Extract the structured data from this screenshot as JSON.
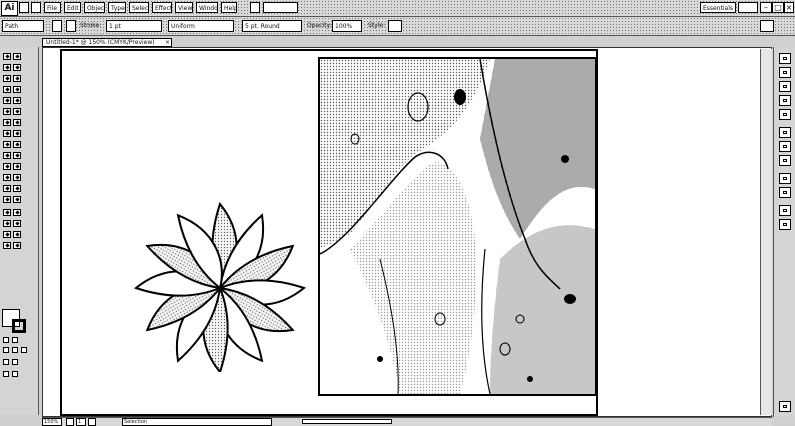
{
  "app": {
    "logo": "Ai"
  },
  "menu": [
    "File",
    "Edit",
    "Object",
    "Type",
    "Select",
    "Effect",
    "View",
    "Window",
    "Help"
  ],
  "workspace": {
    "label": "Essentials"
  },
  "controlbar": {
    "selection": "Path",
    "stroke_label": "Stroke:",
    "stroke_weight": "1 pt",
    "uniform": "Uniform",
    "brush": "5 pt. Round",
    "opacity_label": "Opacity:",
    "opacity": "100%",
    "style_label": "Style:"
  },
  "document": {
    "tab": "Untitled-1* @ 150% (CMYK/Preview)",
    "close": "×"
  },
  "status": {
    "zoom": "150%",
    "page": "1",
    "info": "Selection"
  },
  "icons": {
    "window_minimize": "minimize-icon",
    "window_maximize": "maximize-icon",
    "window_close": "close-icon",
    "fill": "fill-swatch-icon",
    "stroke": "stroke-swatch-icon"
  }
}
